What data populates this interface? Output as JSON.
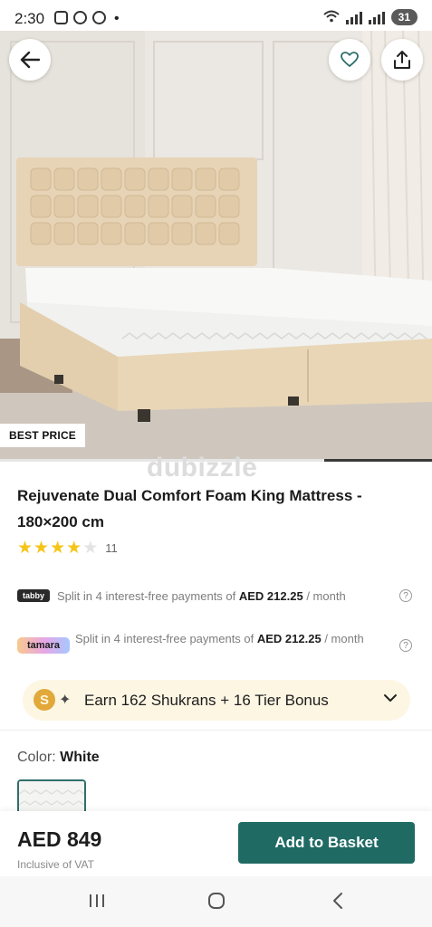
{
  "status_bar": {
    "time": "2:30",
    "dot": "•",
    "battery": "31"
  },
  "hero": {
    "badge": "BEST PRICE",
    "watermark": "dubizzle",
    "slide_index": 3,
    "slide_count": 4
  },
  "product": {
    "title": "Rejuvenate Dual Comfort Foam King Mattress - 180×200 cm",
    "rating": 4,
    "rating_count": "11"
  },
  "tabby": {
    "logo": "tabby",
    "text_before": "Split in 4 interest-free payments of ",
    "amount": "AED 212.25",
    "text_after": " / month"
  },
  "tamara": {
    "logo": "tamara",
    "text_before": "Split in 4 interest-free payments of ",
    "amount": "AED 212.25",
    "text_after": " / month"
  },
  "shukran": {
    "coin": "S",
    "text": "Earn 162 Shukrans + 16 Tier Bonus"
  },
  "color": {
    "label": "Color: ",
    "value": "White"
  },
  "bottom": {
    "price": "AED 849",
    "vat_note": "Inclusive of VAT",
    "add_button": "Add to Basket"
  },
  "colors": {
    "accent": "#206a64",
    "star": "#f5c518",
    "star_empty": "#e3e3e3"
  }
}
